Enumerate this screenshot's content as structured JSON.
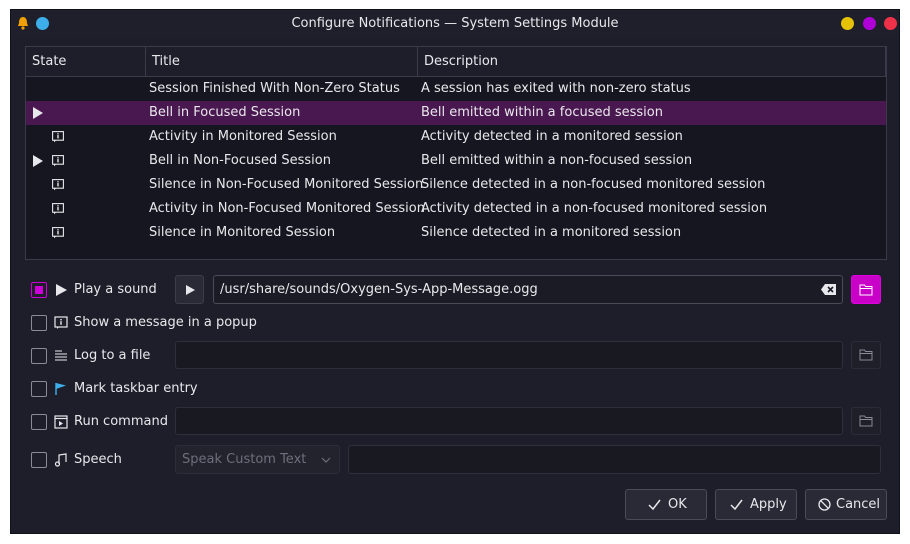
{
  "window": {
    "title": "Configure Notifications — System Settings Module"
  },
  "table": {
    "headers": [
      "State",
      "Title",
      "Description"
    ],
    "rows": [
      {
        "title": "Session Finished With Non-Zero Status",
        "description": "A session has exited with non-zero status",
        "sound": false,
        "popup": false,
        "selected": false
      },
      {
        "title": "Bell in Focused Session",
        "description": "Bell emitted within a focused session",
        "sound": true,
        "popup": false,
        "selected": true
      },
      {
        "title": "Activity in Monitored Session",
        "description": "Activity detected in a monitored session",
        "sound": false,
        "popup": true,
        "selected": false
      },
      {
        "title": "Bell in Non-Focused Session",
        "description": "Bell emitted within a non-focused session",
        "sound": true,
        "popup": true,
        "selected": false
      },
      {
        "title": "Silence in Non-Focused Monitored Session",
        "description": "Silence detected in a non-focused monitored session",
        "sound": false,
        "popup": true,
        "selected": false
      },
      {
        "title": "Activity in Non-Focused Monitored Session",
        "description": "Activity detected in a non-focused monitored session",
        "sound": false,
        "popup": true,
        "selected": false
      },
      {
        "title": "Silence in Monitored Session",
        "description": "Silence detected in a monitored session",
        "sound": false,
        "popup": true,
        "selected": false
      }
    ]
  },
  "options": {
    "play_sound": {
      "label": "Play a sound",
      "checked": true,
      "value": "/usr/share/sounds/Oxygen-Sys-App-Message.ogg"
    },
    "popup": {
      "label": "Show a message in a popup",
      "checked": false
    },
    "log_file": {
      "label": "Log to a file",
      "checked": false,
      "value": ""
    },
    "taskbar": {
      "label": "Mark taskbar entry",
      "checked": false
    },
    "run_command": {
      "label": "Run command",
      "checked": false,
      "value": ""
    },
    "speech": {
      "label": "Speech",
      "checked": false,
      "mode": "Speak Custom Text",
      "value": ""
    }
  },
  "buttons": {
    "ok": "OK",
    "apply": "Apply",
    "cancel": "Cancel"
  },
  "colors": {
    "accent": "#d000d8",
    "selection": "#4a1850",
    "background": "#1e1e2a"
  }
}
